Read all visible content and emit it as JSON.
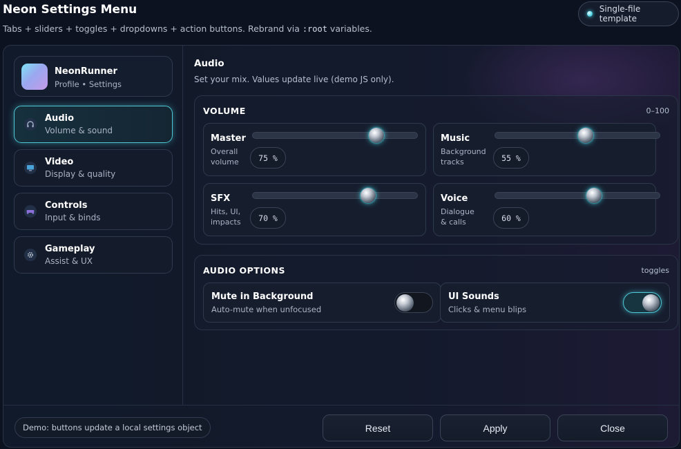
{
  "header": {
    "title": "Neon Settings Menu",
    "subtitle_before": "Tabs + sliders + toggles + dropdowns + action buttons. Rebrand via ",
    "subtitle_code": ":root",
    "subtitle_after": " variables.",
    "badge": "Single-file template"
  },
  "profile": {
    "name": "NeonRunner",
    "subtitle": "Profile • Settings"
  },
  "nav": {
    "items": [
      {
        "label": "Audio",
        "sub": "Volume & sound",
        "icon": "headphones-icon",
        "glyph": "🎧"
      },
      {
        "label": "Video",
        "sub": "Display & quality",
        "icon": "monitor-icon",
        "glyph": "▬"
      },
      {
        "label": "Controls",
        "sub": "Input & binds",
        "icon": "gamepad-icon",
        "glyph": "◆"
      },
      {
        "label": "Gameplay",
        "sub": "Assist & UX",
        "icon": "gear-icon",
        "glyph": "⚙"
      }
    ],
    "active": "Audio"
  },
  "content": {
    "title": "Audio",
    "subtitle": "Set your mix. Values update live (demo JS only)."
  },
  "volume": {
    "title": "VOLUME",
    "range": "0–100",
    "sliders": [
      {
        "label": "Master",
        "desc": "Overall volume",
        "value": 75,
        "display": "75 %"
      },
      {
        "label": "Music",
        "desc": "Background tracks",
        "value": 55,
        "display": "55 %"
      },
      {
        "label": "SFX",
        "desc": "Hits, UI, impacts",
        "value": 70,
        "display": "70 %"
      },
      {
        "label": "Voice",
        "desc": "Dialogue & calls",
        "value": 60,
        "display": "60 %"
      }
    ]
  },
  "options": {
    "title": "AUDIO OPTIONS",
    "meta": "toggles",
    "toggles": [
      {
        "label": "Mute in Background",
        "desc": "Auto-mute when unfocused",
        "on": false
      },
      {
        "label": "UI Sounds",
        "desc": "Clicks & menu blips",
        "on": true
      }
    ]
  },
  "footer": {
    "note": "Demo: buttons update a local settings object",
    "reset": "Reset",
    "apply": "Apply",
    "close": "Close"
  },
  "colors": {
    "accent": "#4fc8d8",
    "background": "#0c1220"
  }
}
